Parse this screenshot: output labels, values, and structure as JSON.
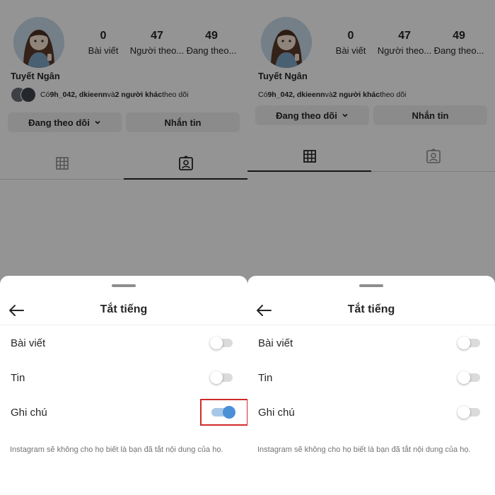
{
  "panels": [
    {
      "id": "before",
      "profile": {
        "name": "Tuyết Ngân",
        "stats": [
          {
            "value": "0",
            "label": "Bài viết"
          },
          {
            "value": "47",
            "label": "Người theo..."
          },
          {
            "value": "49",
            "label": "Đang theo..."
          }
        ],
        "mutuals_prefix": "Có ",
        "mutuals_names": "9h_042, dkieenn",
        "mutuals_mid": " và ",
        "mutuals_others": "2 người khác",
        "mutuals_suffix": " theo dõi",
        "following_button": "Đang theo dõi",
        "message_button": "Nhắn tin",
        "active_tab": "tagged"
      },
      "sheet": {
        "title": "Tắt tiếng",
        "rows": [
          {
            "label": "Bài viết",
            "on": false
          },
          {
            "label": "Tin",
            "on": false
          },
          {
            "label": "Ghi chú",
            "on": true
          }
        ],
        "note": "Instagram sẽ không cho họ biết là bạn đã tắt nội dung của họ."
      },
      "highlight_row": 2
    },
    {
      "id": "after",
      "profile": {
        "name": "Tuyết Ngân",
        "stats": [
          {
            "value": "0",
            "label": "Bài viết"
          },
          {
            "value": "47",
            "label": "Người theo..."
          },
          {
            "value": "49",
            "label": "Đang theo..."
          }
        ],
        "mutuals_prefix": "Có ",
        "mutuals_names": "9h_042, dkieenn",
        "mutuals_mid": " và ",
        "mutuals_others": "2 người khác",
        "mutuals_suffix": " theo dõi",
        "following_button": "Đang theo dõi",
        "message_button": "Nhắn tin",
        "active_tab": "grid"
      },
      "sheet": {
        "title": "Tắt tiếng",
        "rows": [
          {
            "label": "Bài viết",
            "on": false
          },
          {
            "label": "Tin",
            "on": false
          },
          {
            "label": "Ghi chú",
            "on": false
          }
        ],
        "note": "Instagram sẽ không cho họ biết là bạn đã tắt nội dung của họ."
      }
    }
  ],
  "colors": {
    "toggle_on_knob": "#4b8fd6",
    "toggle_on_track": "#a6c7e8",
    "toggle_off_track": "#dbdbdb",
    "highlight": "#d12b2b",
    "overlay": "rgba(0,0,0,0.42)"
  },
  "icons": [
    "back-arrow-icon",
    "grid-icon",
    "tagged-icon",
    "chevron-down-icon",
    "avatar"
  ]
}
